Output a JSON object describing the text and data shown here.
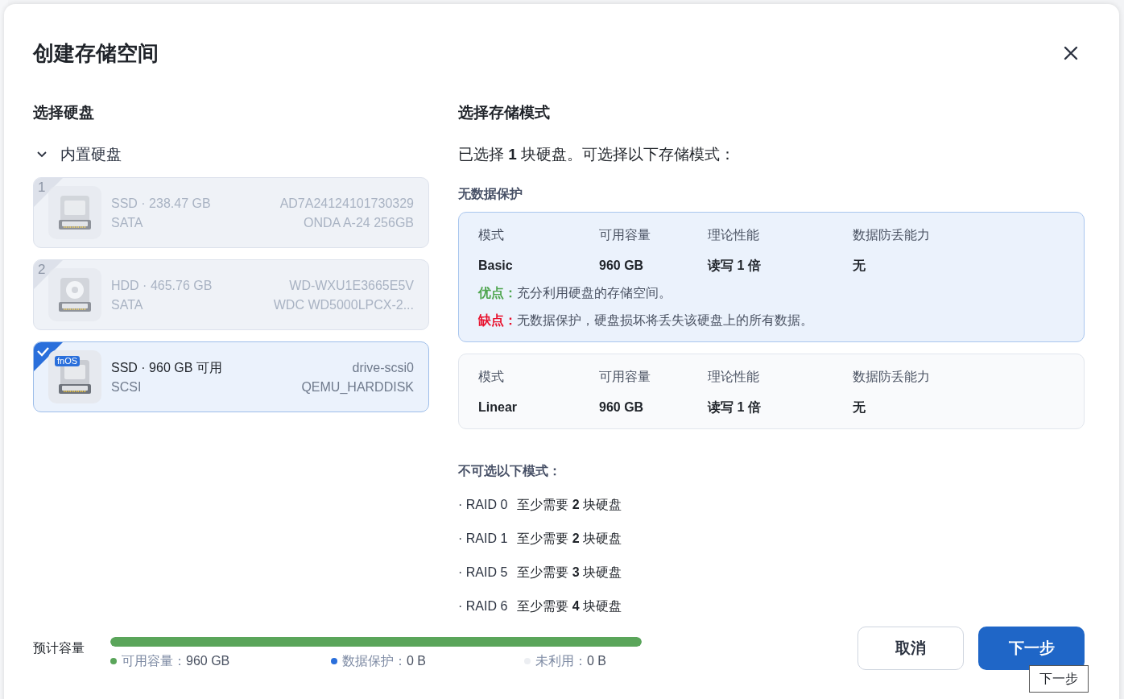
{
  "dialog": {
    "title": "创建存储空间"
  },
  "disk_section": {
    "heading": "选择硬盘",
    "group": {
      "label": "内置硬盘",
      "expanded": true
    },
    "disks": [
      {
        "kind": "ssd",
        "number": "1",
        "type_size": "SSD · 238.47 GB",
        "bus": "SATA",
        "serial": "AD7A24124101730329",
        "model": "ONDA A-24 256GB",
        "selected": false,
        "disabled": true
      },
      {
        "kind": "hdd",
        "number": "2",
        "type_size": "HDD · 465.76 GB",
        "bus": "SATA",
        "serial": "WD-WXU1E3665E5V",
        "model": "WDC WD5000LPCX-2...",
        "selected": false,
        "disabled": true
      },
      {
        "kind": "ssd",
        "badge": "fnOS",
        "type_size": "SSD · 960 GB 可用",
        "bus": "SCSI",
        "serial": "drive-scsi0",
        "model": "QEMU_HARDDISK",
        "selected": true,
        "disabled": false
      }
    ]
  },
  "mode_section": {
    "heading": "选择存储模式",
    "summary": "已选择 **1** 块硬盘。可选择以下存储模式：",
    "group_label": "无数据保护",
    "modes": [
      {
        "selected": true,
        "columns": [
          "模式",
          "可用容量",
          "理论性能",
          "数据防丢能力"
        ],
        "values": [
          "Basic",
          "960 GB",
          "读写 1 倍",
          "无"
        ],
        "pros_label": "优点：",
        "pros": "充分利用硬盘的存储空间。",
        "cons_label": "缺点：",
        "cons": "无数据保护，硬盘损坏将丢失该硬盘上的所有数据。"
      },
      {
        "selected": false,
        "columns": [
          "模式",
          "可用容量",
          "理论性能",
          "数据防丢能力"
        ],
        "values": [
          "Linear",
          "960 GB",
          "读写 1 倍",
          "无"
        ]
      }
    ],
    "unavailable_heading": "不可选以下模式：",
    "unavailable": [
      {
        "name": "· RAID 0",
        "requirement": "至少需要 **2** 块硬盘"
      },
      {
        "name": "· RAID 1",
        "requirement": "至少需要 **2** 块硬盘"
      },
      {
        "name": "· RAID 5",
        "requirement": "至少需要 **3** 块硬盘"
      },
      {
        "name": "· RAID 6",
        "requirement": "至少需要 **4** 块硬盘"
      }
    ]
  },
  "footer": {
    "capacity_label": "预计容量",
    "level": 1,
    "legend": [
      {
        "color": "#5aa55a",
        "label": "可用容量：",
        "value": "960 GB"
      },
      {
        "color": "#2a6fdb",
        "label": "数据保护：",
        "value": "0 B"
      },
      {
        "color": "#eceef2",
        "label": "未利用：",
        "value": "0 B"
      }
    ],
    "cancel": "取消",
    "next": "下一步",
    "tooltip": "下一步"
  }
}
